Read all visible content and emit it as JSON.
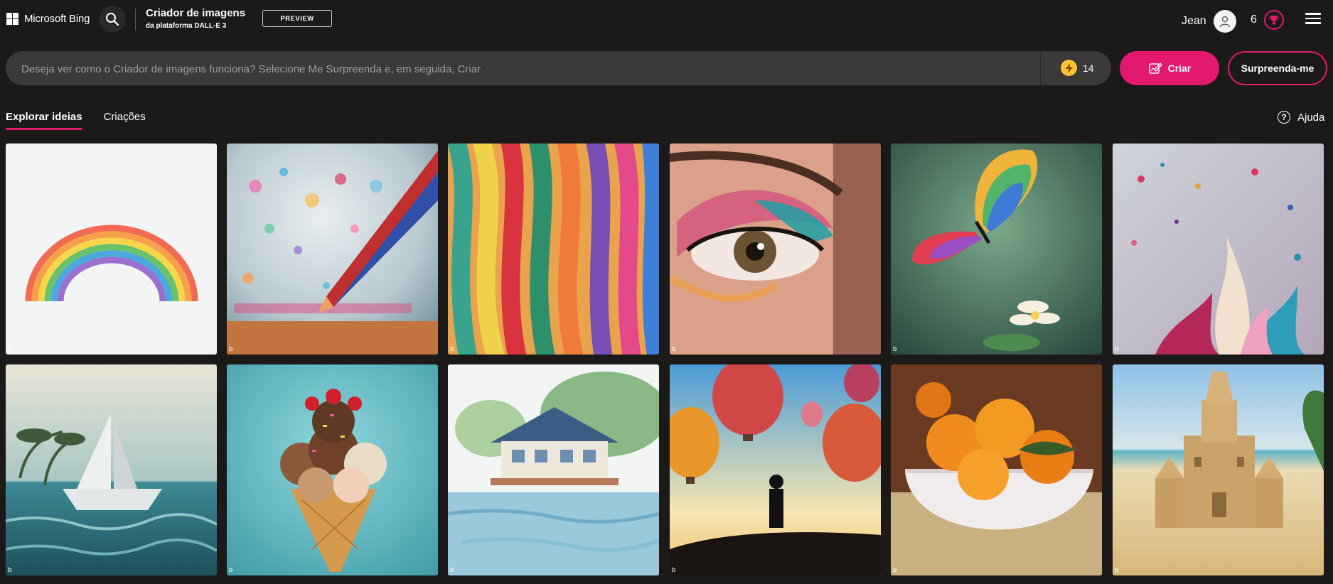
{
  "header": {
    "logo_text": "Microsoft Bing",
    "title": "Criador de imagens",
    "subtitle": "da plataforma DALL-E 3",
    "badge": "PREVIEW",
    "user_name": "Jean",
    "rewards_count": "6"
  },
  "prompt": {
    "placeholder": "Deseja ver como o Criador de imagens funciona? Selecione Me Surpreenda e, em seguida, Criar",
    "boosts": "14",
    "create_label": "Criar",
    "surprise_label": "Surpreenda-me"
  },
  "tabs": [
    {
      "label": "Explorar ideias",
      "active": true
    },
    {
      "label": "Criações",
      "active": false
    }
  ],
  "help_label": "Ajuda",
  "colors": {
    "accent": "#e3186f",
    "background": "#1b1a19",
    "bar": "#3b3a39",
    "boost": "#f8c334"
  },
  "gallery": [
    {
      "name": "rainbow-paper-image",
      "icon": "image"
    },
    {
      "name": "glitter-pencil-image",
      "icon": "image"
    },
    {
      "name": "colorful-ribbons-image",
      "icon": "image"
    },
    {
      "name": "eye-makeup-image",
      "icon": "image"
    },
    {
      "name": "rainbow-butterfly-image",
      "icon": "image"
    },
    {
      "name": "paint-splash-image",
      "icon": "image"
    },
    {
      "name": "paper-boat-image",
      "icon": "image"
    },
    {
      "name": "ice-cream-cone-image",
      "icon": "image"
    },
    {
      "name": "watercolor-house-image",
      "icon": "image"
    },
    {
      "name": "hot-air-balloons-image",
      "icon": "image"
    },
    {
      "name": "oranges-bowl-image",
      "icon": "image"
    },
    {
      "name": "sand-castle-image",
      "icon": "image"
    }
  ]
}
